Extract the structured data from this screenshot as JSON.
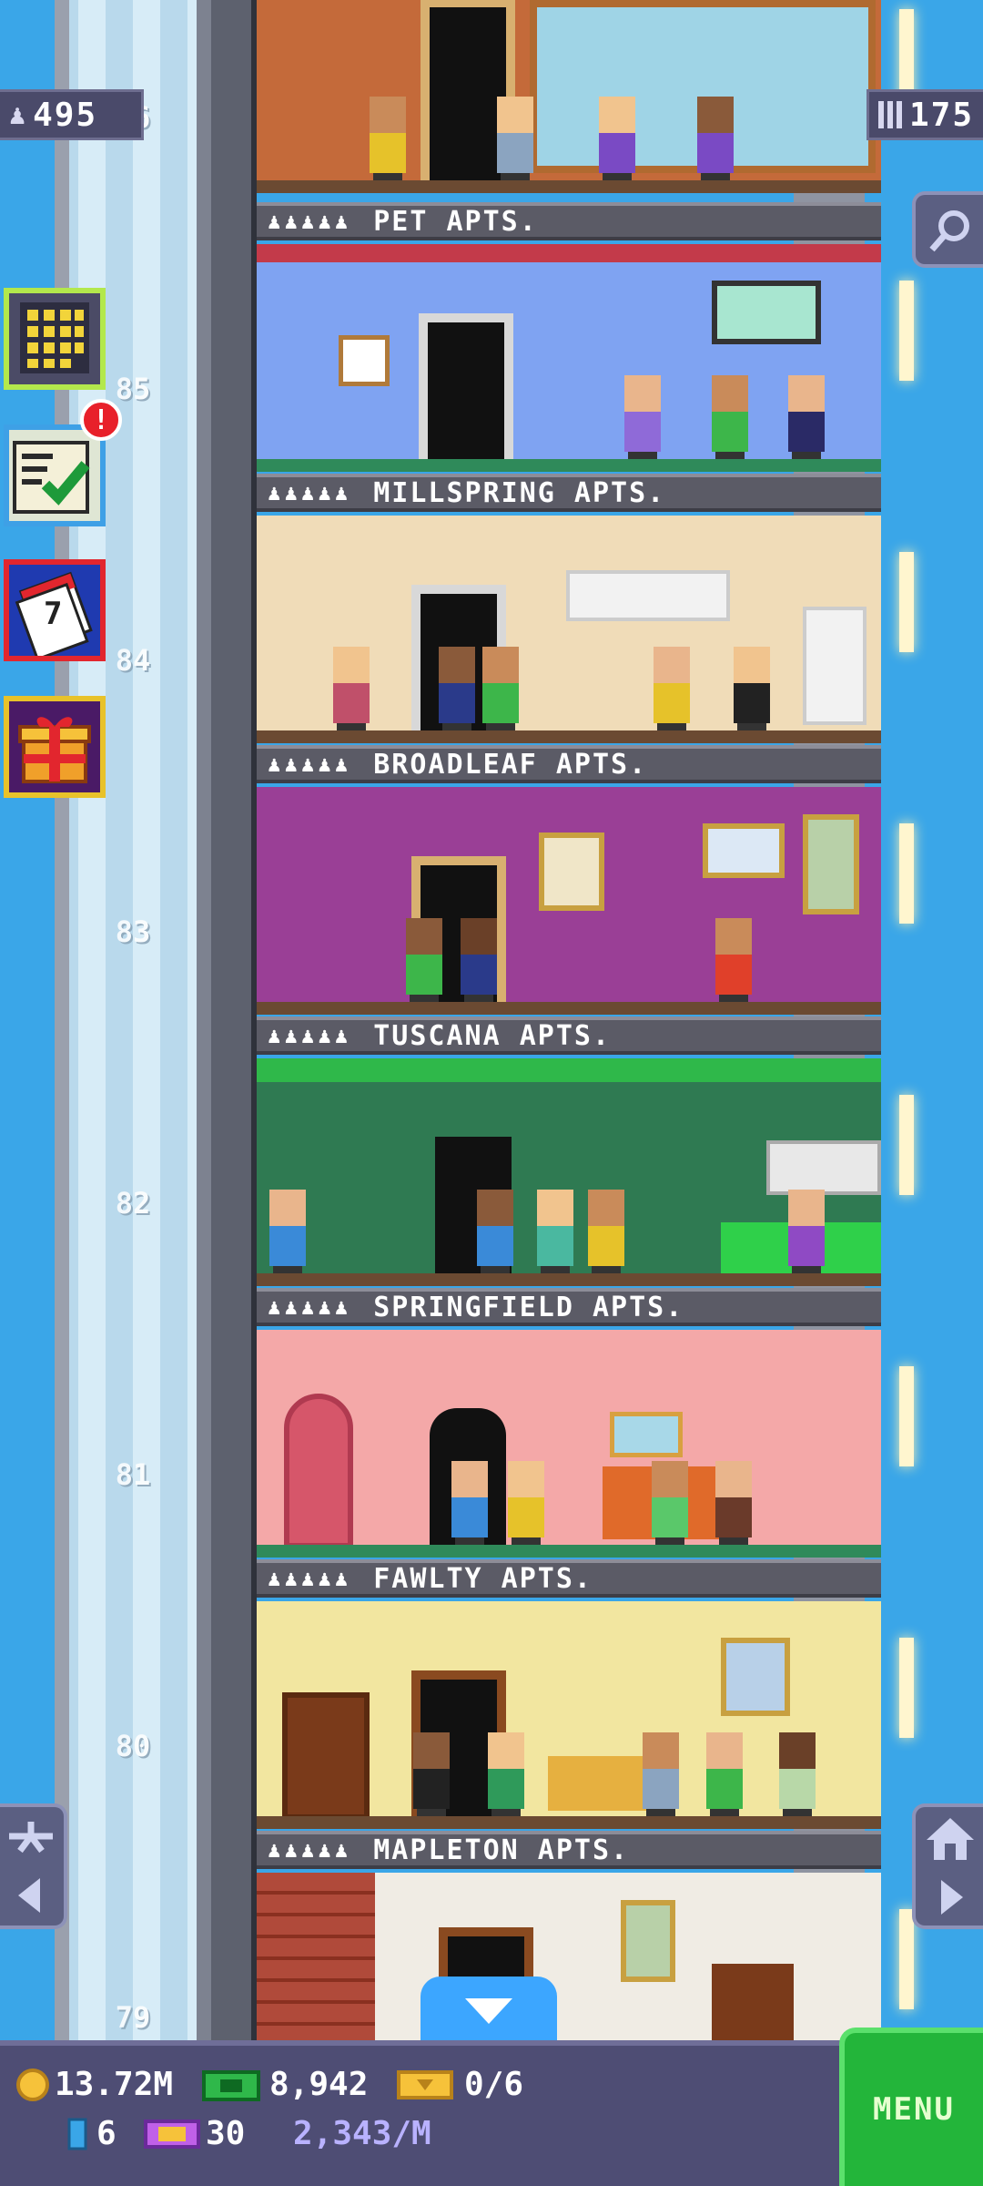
{
  "top": {
    "population": "495",
    "floors": "175",
    "search_icon": "magnifier-icon"
  },
  "side_buttons": {
    "buildings_icon": "building-icon",
    "missions_icon": "checklist-icon",
    "missions_badge": "!",
    "calendar_icon": "calendar-icon",
    "calendar_day": "7",
    "gift_icon": "gift-icon"
  },
  "elevator": {
    "floor_numbers": [
      "86",
      "85",
      "84",
      "83",
      "82",
      "81",
      "80",
      "79"
    ]
  },
  "floors": [
    {
      "label": "PET APTS."
    },
    {
      "label": "MILLSPRING APTS."
    },
    {
      "label": "BROADLEAF APTS."
    },
    {
      "label": "TUSCANA APTS."
    },
    {
      "label": "SPRINGFIELD APTS."
    },
    {
      "label": "FAWLTY APTS."
    },
    {
      "label": "MAPLETON APTS."
    }
  ],
  "residents_icon": "♟♟♟♟♟",
  "bottom": {
    "coins": "13.72M",
    "bux": "8,942",
    "tickets": "0/6",
    "bitizen_count": "6",
    "vip_count": "30",
    "rate": "2,343/M",
    "menu_label": "MENU"
  },
  "colors": {
    "sky": "#3aa6e8",
    "menu_green": "#23b53a",
    "bottom_bar": "#4e4d74"
  }
}
